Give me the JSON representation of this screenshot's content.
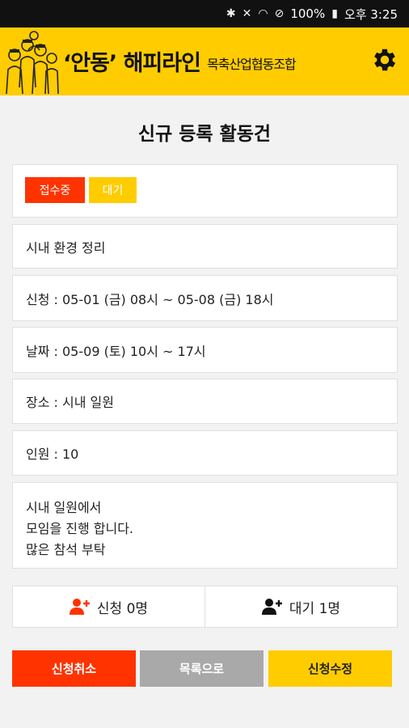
{
  "status": {
    "bluetooth_icon": "bluetooth-icon",
    "mute_icon": "vibrate-mute-icon",
    "wifi_icon": "wifi-icon",
    "dnd_icon": "do-not-disturb-icon",
    "battery": "100%",
    "time": "오후 3:25"
  },
  "header": {
    "title": "‘안동’ 해피라인",
    "subtitle": "목축산업협동조합",
    "settings_icon": "gear-icon"
  },
  "page_title": "신규 등록 활동건",
  "badges": {
    "status": "접수중",
    "wait": "대기"
  },
  "activity": {
    "name": "시내 환경 정리",
    "apply_period": "신청 : 05-01 (금) 08시 ~ 05-08 (금) 18시",
    "date": "날짜 : 05-09 (토) 10시 ~ 17시",
    "place": "장소 : 시내 일원",
    "people": "인원 : 10",
    "description": [
      "시내 일원에서",
      "모임을 진행 합니다.",
      "많은 참석 부탁"
    ]
  },
  "counts": {
    "applied": "신청 0명",
    "waiting": "대기 1명"
  },
  "buttons": {
    "cancel": "신청취소",
    "list": "목록으로",
    "edit": "신청수정"
  },
  "colors": {
    "brand_yellow": "#ffcc00",
    "accent_red": "#ff3300",
    "neutral_gray": "#a9a9a9"
  }
}
